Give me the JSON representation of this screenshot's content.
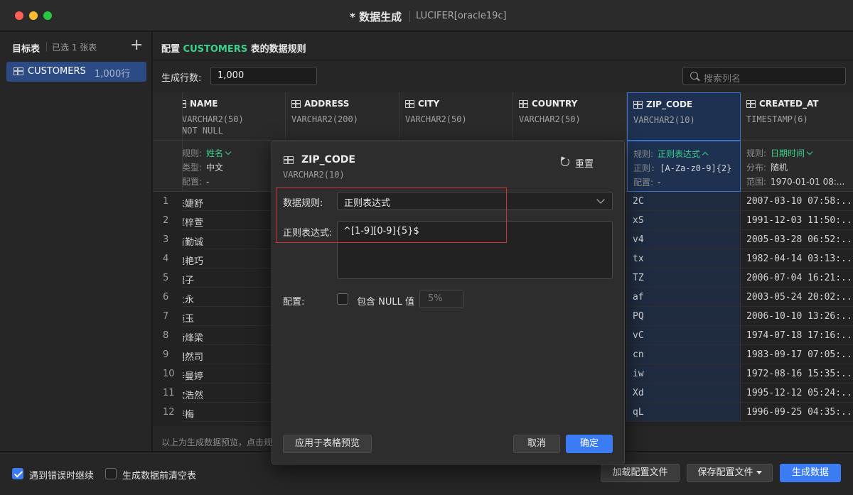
{
  "window": {
    "title": "* 数据生成",
    "connection": "LUCIFER[oracle19c]"
  },
  "sidebar": {
    "header": "目标表",
    "selected_count": "已选 1 张表",
    "add_label": "+",
    "tables": [
      {
        "name": "CUSTOMERS",
        "rows": "1,000行"
      }
    ]
  },
  "main": {
    "config_prefix": "配置 ",
    "table_name": "CUSTOMERS",
    "config_suffix": " 表的数据规则",
    "rows_label": "生成行数:",
    "rows_value": "1,000",
    "search_placeholder": "搜索列名",
    "preview_hint": "以上为生成数据预览，点击规"
  },
  "columns": [
    {
      "name": "NAME",
      "type": "VARCHAR2(50)",
      "type2": "NOT NULL",
      "rule_label": "规则:",
      "rule": "姓名",
      "sub_label": "类型:",
      "sub_value": "中文",
      "cfg_label": "配置:",
      "cfg_value": "-"
    },
    {
      "name": "ADDRESS",
      "type": "VARCHAR2(200)",
      "type2": ""
    },
    {
      "name": "CITY",
      "type": "VARCHAR2(50)",
      "type2": ""
    },
    {
      "name": "COUNTRY",
      "type": "VARCHAR2(50)",
      "type2": ""
    },
    {
      "name": "ZIP_CODE",
      "type": "VARCHAR2(10)",
      "type2": "",
      "rule_label": "规则:",
      "rule": "正则表达式",
      "sub_label": "正则:",
      "sub_value": "[A-Za-z0-9]{2}",
      "cfg_label": "配置:",
      "cfg_value": "-"
    },
    {
      "name": "CREATED_AT",
      "type": "TIMESTAMP(6)",
      "type2": "",
      "rule_label": "规则:",
      "rule": "日期时间",
      "sub_label": "分布:",
      "sub_value": "随机",
      "cfg_label": "范围:",
      "cfg_value": "1970-01-01 08:..."
    }
  ],
  "rows": [
    {
      "n": "1",
      "name": "朱婕舒",
      "zip": "2C",
      "created": "2007-03-10 07:58:..."
    },
    {
      "n": "2",
      "name": "覃梓萱",
      "zip": "xS",
      "created": "1991-12-03 11:50:..."
    },
    {
      "n": "3",
      "name": "苗勤诚",
      "zip": "v4",
      "created": "2005-03-28 06:52:..."
    },
    {
      "n": "4",
      "name": "鲍艳巧",
      "zip": "tx",
      "created": "1982-04-14 03:13:..."
    },
    {
      "n": "5",
      "name": "魏子",
      "zip": "TZ",
      "created": "2006-07-04 16:21:..."
    },
    {
      "n": "6",
      "name": "杜永",
      "zip": "af",
      "created": "2003-05-24 20:02:..."
    },
    {
      "n": "7",
      "name": "施玉",
      "zip": "PQ",
      "created": "2006-10-10 13:26:..."
    },
    {
      "n": "8",
      "name": "杨烽梁",
      "zip": "vC",
      "created": "1974-07-18 17:16:..."
    },
    {
      "n": "9",
      "name": "胡然司",
      "zip": "cn",
      "created": "1983-09-17 07:05:..."
    },
    {
      "n": "10",
      "name": "辛曼婷",
      "zip": "iw",
      "created": "1972-08-16 15:35:..."
    },
    {
      "n": "11",
      "name": "欧浩然",
      "zip": "Xd",
      "created": "1995-12-12 05:24:..."
    },
    {
      "n": "12",
      "name": "李梅",
      "zip": "qL",
      "created": "1996-09-25 04:35:..."
    }
  ],
  "modal": {
    "column": "ZIP_CODE",
    "type": "VARCHAR2(10)",
    "reset_label": "重置",
    "rule_label": "数据规则:",
    "rule_value": "正则表达式",
    "regex_label": "正则表达式:",
    "regex_value": "^[1-9][0-9]{5}$",
    "config_label": "配置:",
    "include_null_label": "包含 NULL 值",
    "include_null_checked": false,
    "null_percent": "5%",
    "apply_label": "应用于表格预览",
    "cancel_label": "取消",
    "ok_label": "确定"
  },
  "footer": {
    "continue_on_error_label": "遇到错误时继续",
    "continue_on_error_checked": true,
    "clear_before_label": "生成数据前清空表",
    "clear_before_checked": false,
    "load_config_label": "加载配置文件",
    "save_config_label": "保存配置文件",
    "generate_label": "生成数据"
  },
  "colors": {
    "accent": "#3b7cf5",
    "table_name_green": "#3ad18a",
    "highlight_red": "#d03232",
    "selection": "#2c4a83"
  }
}
